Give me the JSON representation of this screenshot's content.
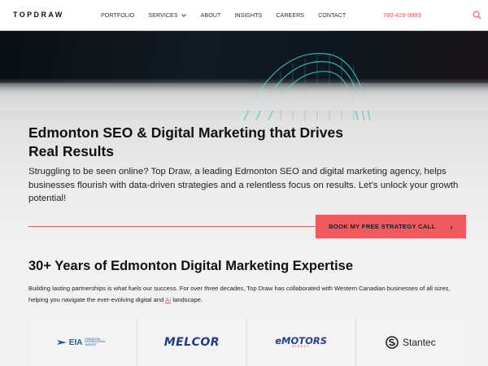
{
  "header": {
    "logo": "TOPDRAW",
    "nav": [
      {
        "label": "PORTFOLIO"
      },
      {
        "label": "SERVICES"
      },
      {
        "label": "ABOUT"
      },
      {
        "label": "INSIGHTS"
      },
      {
        "label": "CAREERS"
      },
      {
        "label": "CONTACT"
      }
    ],
    "phone": "780-429-9993",
    "icons": {
      "search": "search-icon",
      "services_dropdown": "chevron-down-icon"
    }
  },
  "hero": {
    "title": "Edmonton SEO & Digital Marketing that Drives Real Results",
    "text": "Struggling to be seen online? Top Draw, a leading Edmonton SEO and digital marketing agency, helps businesses flourish with data-driven strategies and a relentless focus on results. Let's unlock your growth potential!",
    "cta_label": "BOOK MY FREE STRATEGY CALL",
    "cta_arrow": "›"
  },
  "expertise": {
    "title": "30+ Years of Edmonton Digital Marketing Expertise",
    "text_before": "Building lasting partnerships is what fuels our success. For over three decades, Top Draw has collaborated with Western Canadian businesses of all sizes, helping you navigate the ever-evolving digital and ",
    "link": "AI",
    "text_after": " landscape."
  },
  "clients": {
    "eia": {
      "mark": "EIA",
      "sub": "EDMONTON INTERNATIONAL AIRPORT"
    },
    "melcor": "MELCOR",
    "emotors": {
      "main": "eMOTORS",
      "sub": "DIRECT"
    },
    "stantec": "Stantec"
  },
  "colors": {
    "accent": "#f05a5f",
    "phone": "#e85a5a",
    "melcor": "#1a3e8c",
    "eia": "#1f5fa6"
  }
}
